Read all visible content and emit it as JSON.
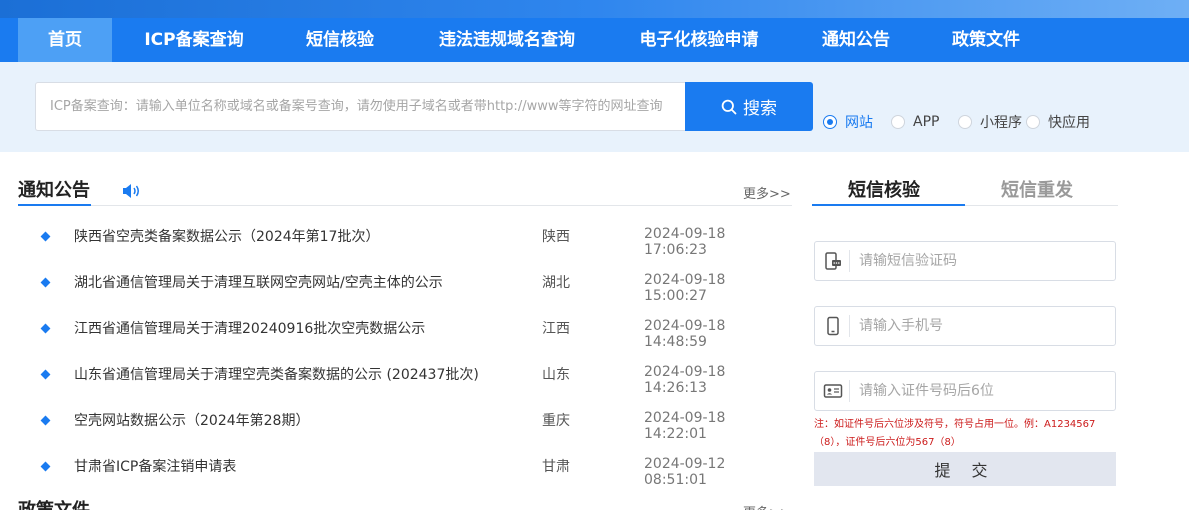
{
  "nav": {
    "items": [
      {
        "label": "首页",
        "active": true
      },
      {
        "label": "ICP备案查询"
      },
      {
        "label": "短信核验"
      },
      {
        "label": "违法违规域名查询"
      },
      {
        "label": "电子化核验申请"
      },
      {
        "label": "通知公告"
      },
      {
        "label": "政策文件"
      }
    ]
  },
  "search": {
    "placeholder": "ICP备案查询：请输入单位名称或域名或备案号查询，请勿使用子域名或者带http://www等字符的网址查询",
    "value": "",
    "button_label": "搜索",
    "options": [
      {
        "label": "网站",
        "checked": true
      },
      {
        "label": "APP"
      },
      {
        "label": "小程序"
      },
      {
        "label": "快应用"
      }
    ]
  },
  "notices": {
    "title": "通知公告",
    "more": "更多>>",
    "items": [
      {
        "title": "陕西省空壳类备案数据公示（2024年第17批次）",
        "region": "陕西",
        "date": "2024-09-18 17:06:23"
      },
      {
        "title": "湖北省通信管理局关于清理互联网空壳网站/空壳主体的公示",
        "region": "湖北",
        "date": "2024-09-18 15:00:27"
      },
      {
        "title": "江西省通信管理局关于清理20240916批次空壳数据公示",
        "region": "江西",
        "date": "2024-09-18 14:48:59"
      },
      {
        "title": "山东省通信管理局关于清理空壳类备案数据的公示 (202437批次)",
        "region": "山东",
        "date": "2024-09-18 14:26:13"
      },
      {
        "title": "空壳网站数据公示（2024年第28期）",
        "region": "重庆",
        "date": "2024-09-18 14:22:01"
      },
      {
        "title": "甘肃省ICP备案注销申请表",
        "region": "甘肃",
        "date": "2024-09-12 08:51:01"
      }
    ]
  },
  "policies": {
    "title": "政策文件",
    "more": "更多>>"
  },
  "sms": {
    "tabs": [
      {
        "label": "短信核验",
        "active": true
      },
      {
        "label": "短信重发"
      }
    ],
    "code_placeholder": "请输短信验证码",
    "phone_placeholder": "请输入手机号",
    "id_placeholder": "请输入证件号码后6位",
    "note": "注：如证件号后六位涉及符号，符号占用一位。例：A1234567（8），证件号后六位为567（8）",
    "submit_label": "提 交"
  },
  "colors": {
    "primary": "#1a7bf0",
    "nav_active": "#4da0f5",
    "search_band": "#e8f2fc",
    "note_red": "#cc1b1b"
  }
}
